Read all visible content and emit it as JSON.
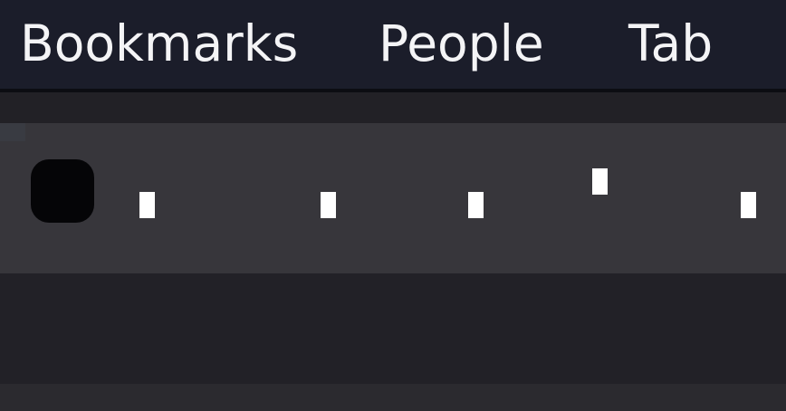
{
  "menubar": {
    "items": [
      {
        "label": "Bookmarks"
      },
      {
        "label": "People"
      },
      {
        "label": "Tab"
      }
    ]
  },
  "tab": {
    "favicon_icon": "black-rounded-square-icon",
    "loading_indicator_icon": "tick-marks-icon"
  },
  "colors": {
    "menubar_bg": "#1b1d2a",
    "menu_text": "#f4f4f6",
    "tab_row_bg": "#37363b",
    "toolbar_bg": "#222127"
  }
}
